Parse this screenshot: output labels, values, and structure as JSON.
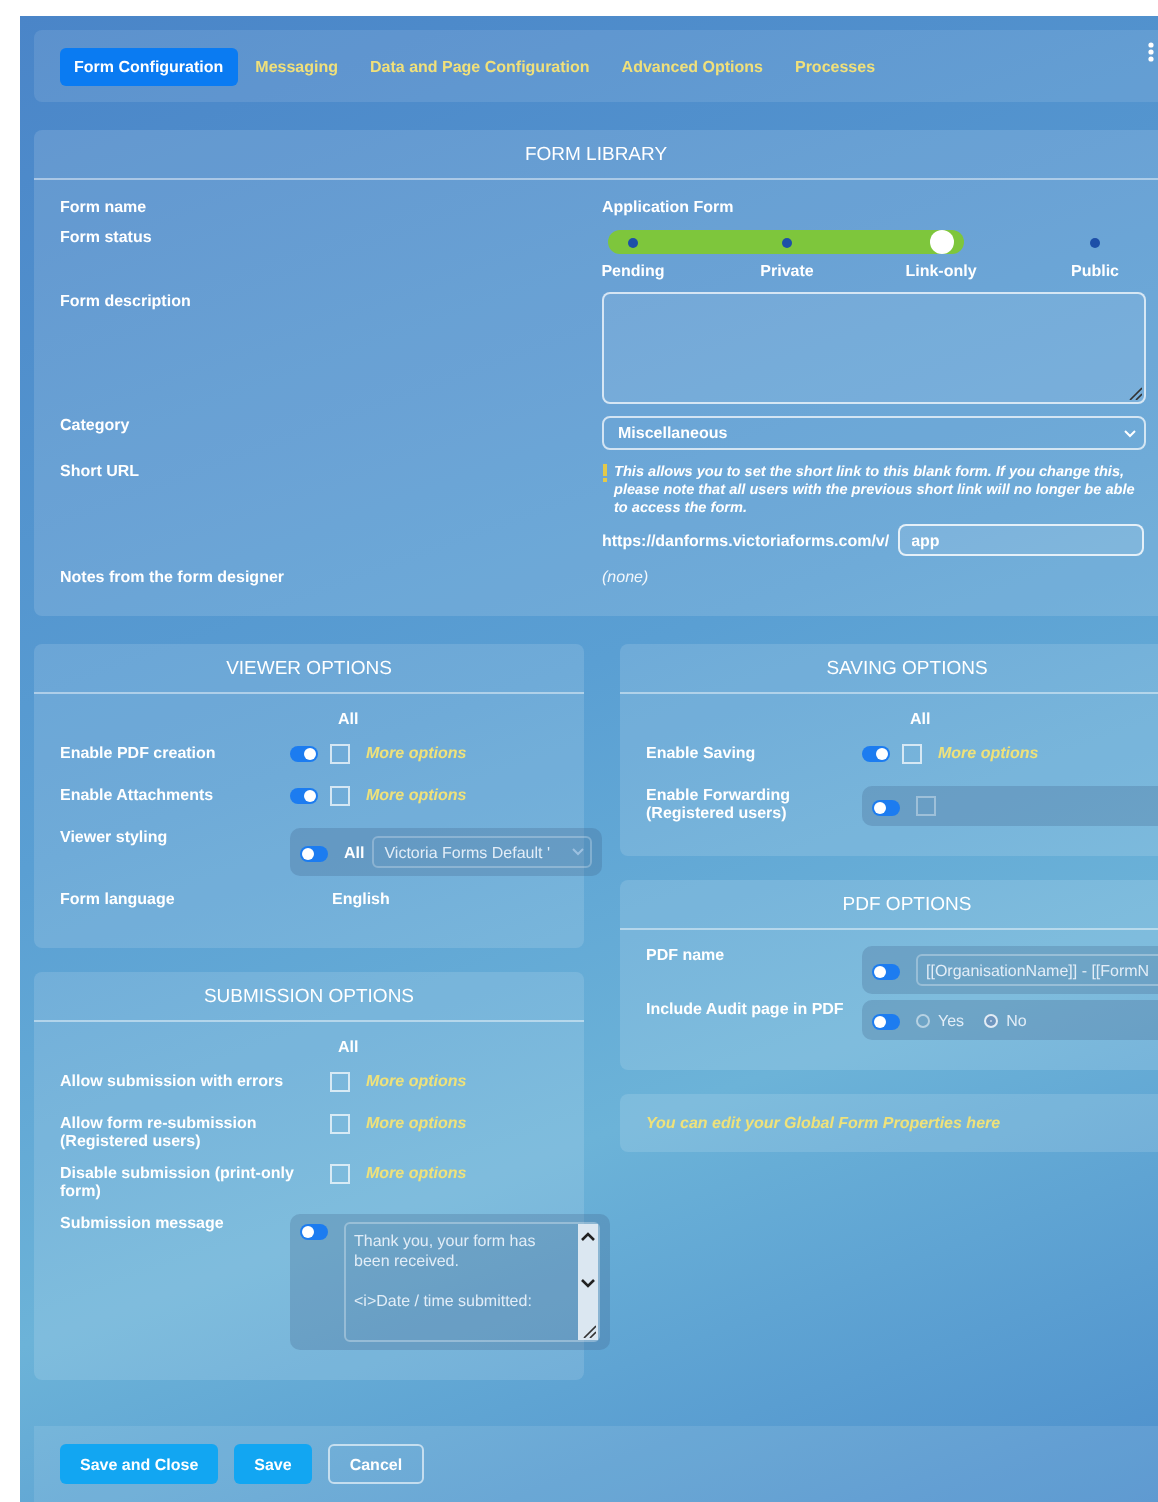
{
  "tabs": [
    {
      "label": "Form Configuration",
      "selected": true
    },
    {
      "label": "Messaging",
      "selected": false
    },
    {
      "label": "Data and Page Configuration",
      "selected": false
    },
    {
      "label": "Advanced Options",
      "selected": false
    },
    {
      "label": "Processes",
      "selected": false
    }
  ],
  "form_library": {
    "title": "FORM LIBRARY",
    "form_name": {
      "label": "Form name",
      "value": "Application Form"
    },
    "form_status": {
      "label": "Form status",
      "options": [
        {
          "label": "Pending",
          "selected": false
        },
        {
          "label": "Private",
          "selected": false
        },
        {
          "label": "Link-only",
          "selected": true
        },
        {
          "label": "Public",
          "selected": false
        }
      ]
    },
    "form_description": {
      "label": "Form description"
    },
    "category": {
      "label": "Category",
      "value": "Miscellaneous"
    },
    "short_url": {
      "label": "Short URL",
      "note": "This allows you to set the short link to this blank form. If you **change this**, please note that all users with the previous short link will no longer be able to access the form.",
      "prefix": "https://danforms.victoriaforms.com/v/",
      "value": "app"
    },
    "notes": {
      "label": "Notes from the form designer",
      "value": "(none)"
    }
  },
  "viewer_options": {
    "title": "VIEWER OPTIONS",
    "column_header": "All",
    "rows": [
      {
        "kind": "toggle_check",
        "label": "Enable PDF creation",
        "on": true,
        "checked": false,
        "link": "More options"
      },
      {
        "kind": "toggle_check",
        "label": "Enable Attachments",
        "on": true,
        "checked": false,
        "link": "More options"
      },
      {
        "kind": "toggle_select",
        "label": "Viewer styling",
        "on": false,
        "option": "All",
        "value": "Victoria Forms Default '"
      },
      {
        "kind": "text",
        "label": "Form language",
        "value": "English"
      }
    ]
  },
  "submission_options": {
    "title": "SUBMISSION OPTIONS",
    "column_header": "All",
    "rows": [
      {
        "kind": "check",
        "label": "Allow submission with errors",
        "checked": false,
        "link": "More options"
      },
      {
        "kind": "check",
        "label": "Allow form re-submission\n(Registered users)",
        "checked": false,
        "link": "More options"
      },
      {
        "kind": "check",
        "label": "Disable submission (print-only form)",
        "checked": false,
        "link": "More options"
      },
      {
        "kind": "toggle_textarea",
        "label": "Submission message",
        "on": false,
        "value": "Thank you, your form has been received.\n\n<i>Date / time submitted:"
      }
    ]
  },
  "saving_options": {
    "title": "SAVING OPTIONS",
    "column_header": "All",
    "rows": [
      {
        "kind": "toggle_check",
        "label": "Enable Saving",
        "on": true,
        "checked": false,
        "link": "More options"
      },
      {
        "kind": "toggle_check_group",
        "label": "Enable Forwarding\n(Registered users)",
        "on": false,
        "checked": false
      }
    ]
  },
  "pdf_options": {
    "title": "PDF OPTIONS",
    "rows": [
      {
        "kind": "toggle_input",
        "label": "PDF name",
        "on": false,
        "value": "[[OrganisationName]] - [[FormN"
      },
      {
        "kind": "toggle_radio",
        "label": "Include Audit page in PDF",
        "on": false,
        "options": [
          {
            "label": "Yes",
            "selected": false
          },
          {
            "label": "No",
            "selected": true
          }
        ]
      }
    ]
  },
  "global_note": "You can edit your Global Form Properties here",
  "buttons": [
    {
      "label": "Save and Close",
      "kind": "primary"
    },
    {
      "label": "Save",
      "kind": "primary"
    },
    {
      "label": "Cancel",
      "kind": "outline"
    }
  ]
}
